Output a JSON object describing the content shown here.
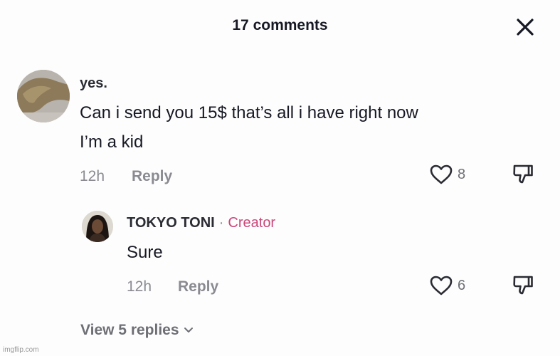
{
  "header": {
    "title": "17 comments"
  },
  "comment": {
    "username": "yes.",
    "text_line1": "Can i send you 15$ that’s all i have right now",
    "text_line2": "I’m a kid",
    "time": "12h",
    "reply_label": "Reply",
    "likes": "8"
  },
  "reply": {
    "username": "TOKYO TONI",
    "separator": "·",
    "badge": "Creator",
    "text": "Sure",
    "time": "12h",
    "reply_label": "Reply",
    "likes": "6"
  },
  "view_replies": {
    "label": "View 5 replies"
  },
  "watermark": "imgflip.com",
  "icons": {
    "close": "close-icon",
    "like": "heart-icon",
    "dislike": "thumbs-down-icon",
    "chevron": "chevron-down-icon"
  },
  "colors": {
    "text": "#161823",
    "muted": "#8a8b91",
    "creator": "#c9477a"
  }
}
